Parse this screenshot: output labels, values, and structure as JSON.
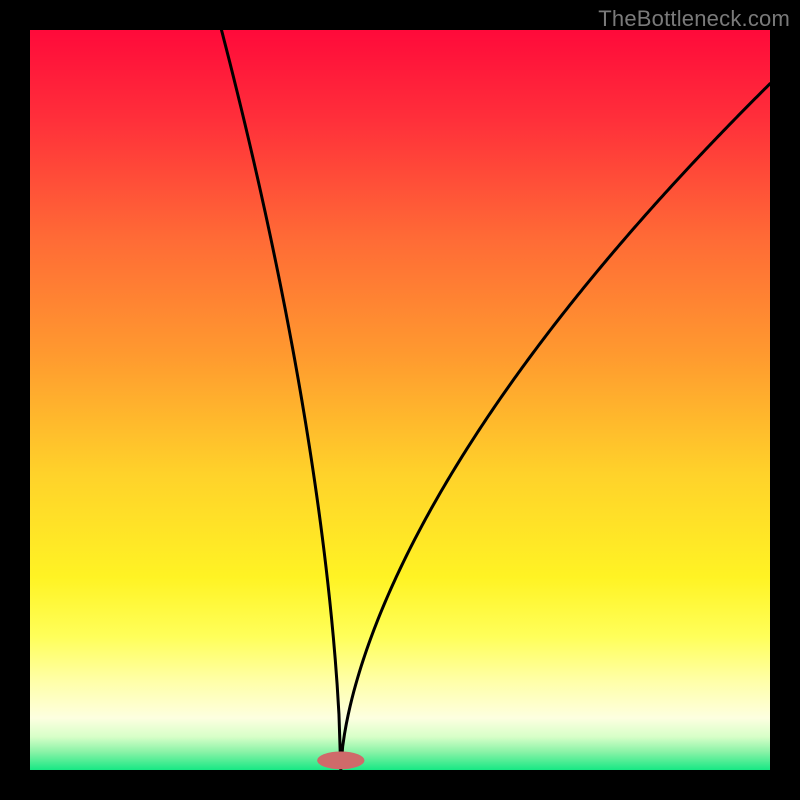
{
  "watermark": "TheBottleneck.com",
  "colors": {
    "frame": "#000000",
    "curve": "#000000",
    "marker_fill": "#cf6a6a",
    "gradient_stops": [
      {
        "offset": 0.0,
        "color": "#ff0a3a"
      },
      {
        "offset": 0.12,
        "color": "#ff2f3a"
      },
      {
        "offset": 0.28,
        "color": "#ff6a36"
      },
      {
        "offset": 0.44,
        "color": "#ff9a2f"
      },
      {
        "offset": 0.6,
        "color": "#ffd22a"
      },
      {
        "offset": 0.74,
        "color": "#fff324"
      },
      {
        "offset": 0.82,
        "color": "#ffff5a"
      },
      {
        "offset": 0.88,
        "color": "#ffffa8"
      },
      {
        "offset": 0.93,
        "color": "#fdffe0"
      },
      {
        "offset": 0.955,
        "color": "#d8ffc8"
      },
      {
        "offset": 0.975,
        "color": "#8cf3a8"
      },
      {
        "offset": 1.0,
        "color": "#17e884"
      }
    ]
  },
  "chart_data": {
    "type": "line",
    "title": "",
    "xlabel": "",
    "ylabel": "",
    "xlim": [
      0,
      100
    ],
    "ylim": [
      0,
      100
    ],
    "grid": false,
    "curve": {
      "exponent": 0.62,
      "left_scale": 310,
      "right_scale": 130
    },
    "minimum": {
      "x": 42,
      "y": 0
    },
    "marker": {
      "x": 42,
      "y": 1.3,
      "rx": 3.2,
      "ry": 1.2
    }
  }
}
